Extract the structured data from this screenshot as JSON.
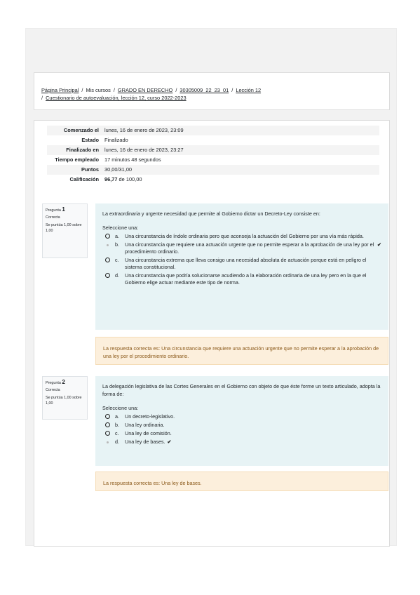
{
  "breadcrumb": {
    "home": "Página Principal",
    "my_courses": "Mis cursos",
    "degree": "GRADO EN DERECHO",
    "course_code": "30305009_22_23_01",
    "lesson": "Lección 12",
    "quiz": "Cuestionario de autoevaluación, lección 12, curso 2022-2023"
  },
  "summary": {
    "rows": [
      {
        "label": "Comenzado el",
        "value": "lunes, 16 de enero de 2023, 23:09"
      },
      {
        "label": "Estado",
        "value": "Finalizado"
      },
      {
        "label": "Finalizado en",
        "value": "lunes, 16 de enero de 2023, 23:27"
      },
      {
        "label": "Tiempo empleado",
        "value": "17 minutos 48 segundos"
      },
      {
        "label": "Puntos",
        "value": "30,00/31,00"
      },
      {
        "label": "Calificación",
        "value_bold": "96,77",
        "value_rest": " de 100,00"
      }
    ]
  },
  "questions": [
    {
      "prefix": "Pregunta",
      "number": "1",
      "state": "Correcta",
      "score": "Se puntúa 1,00 sobre 1,00",
      "text": "La extraordinaria y urgente necesidad que permite al Gobierno dictar un Decreto-Ley consiste en:",
      "prompt": "Seleccione una:",
      "answers": [
        {
          "letter": "a.",
          "text": "Una circunstancia de índole ordinaria pero que aconseja la actuación del Gobierno por una vía más rápida.",
          "selected": false
        },
        {
          "letter": "b.",
          "text": "Una circunstancia que requiere una actuación urgente que no permite esperar a la aprobación de una ley por el procedimiento ordinario.",
          "selected": true
        },
        {
          "letter": "c.",
          "text": "Una circunstancia extrema que lleva consigo una necesidad absoluta de actuación porque está en peligro el sistema constitucional.",
          "selected": false
        },
        {
          "letter": "d.",
          "text": "Una circunstancia que podría solucionarse acudiendo a la elaboración ordinaria de una ley pero en la que el Gobierno elige actuar mediante este tipo de norma.",
          "selected": false
        }
      ],
      "feedback": "La respuesta correcta es: Una circunstancia que requiere una actuación urgente que no permite esperar a la aprobación de una ley por el procedimiento ordinario."
    },
    {
      "prefix": "Pregunta",
      "number": "2",
      "state": "Correcta",
      "score": "Se puntúa 1,00 sobre 1,00",
      "text": "La delegación legislativa de las Cortes Generales en el Gobierno con objeto de que éste forme un texto articulado, adopta la forma de:",
      "prompt": "Seleccione una:",
      "answers": [
        {
          "letter": "a.",
          "text": "Un decreto-legislativo.",
          "selected": false
        },
        {
          "letter": "b.",
          "text": "Una ley ordinaria.",
          "selected": false
        },
        {
          "letter": "c.",
          "text": "Una ley de comisión.",
          "selected": false
        },
        {
          "letter": "d.",
          "text": "Una ley de bases.",
          "selected": true
        }
      ],
      "feedback": "La respuesta correcta es: Una ley de bases."
    }
  ],
  "icons": {
    "correct": "check-icon",
    "option": "radio-icon"
  },
  "colors": {
    "question_bg": "#e7f3f5",
    "feedback_bg": "#fcefdc",
    "feedback_text": "#8b5a1b"
  }
}
